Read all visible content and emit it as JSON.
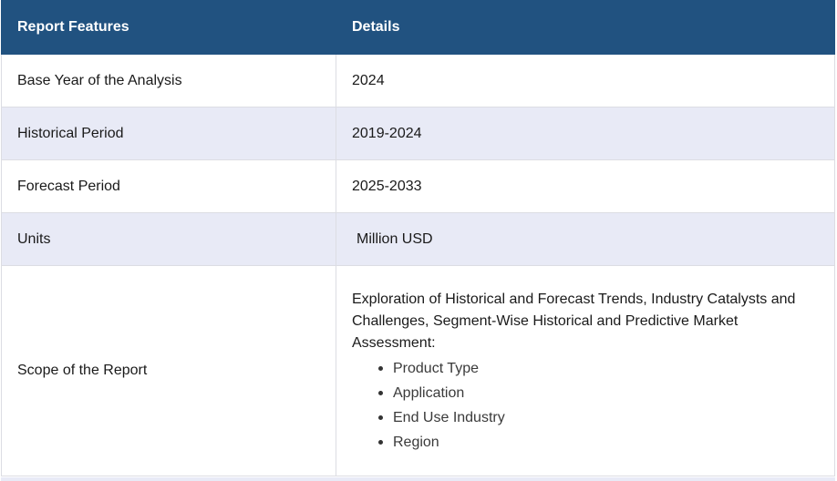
{
  "header": {
    "col1": "Report Features",
    "col2": "Details"
  },
  "rows": [
    {
      "feature": "Base Year of the Analysis",
      "detail": "2024"
    },
    {
      "feature": "Historical Period",
      "detail": "2019-2024"
    },
    {
      "feature": "Forecast Period",
      "detail": "2025-2033"
    },
    {
      "feature": "Units",
      "detail": "Million USD"
    }
  ],
  "scope": {
    "feature": "Scope of the Report",
    "intro": "Exploration of Historical and Forecast Trends, Industry Catalysts and Challenges, Segment-Wise Historical and Predictive Market Assessment:",
    "items": [
      "Product Type",
      "Application",
      "End Use Industry",
      "Region"
    ]
  },
  "colors": {
    "header_bg": "#215280",
    "alt_row_bg": "#e8eaf6",
    "border": "#dcdde3"
  }
}
